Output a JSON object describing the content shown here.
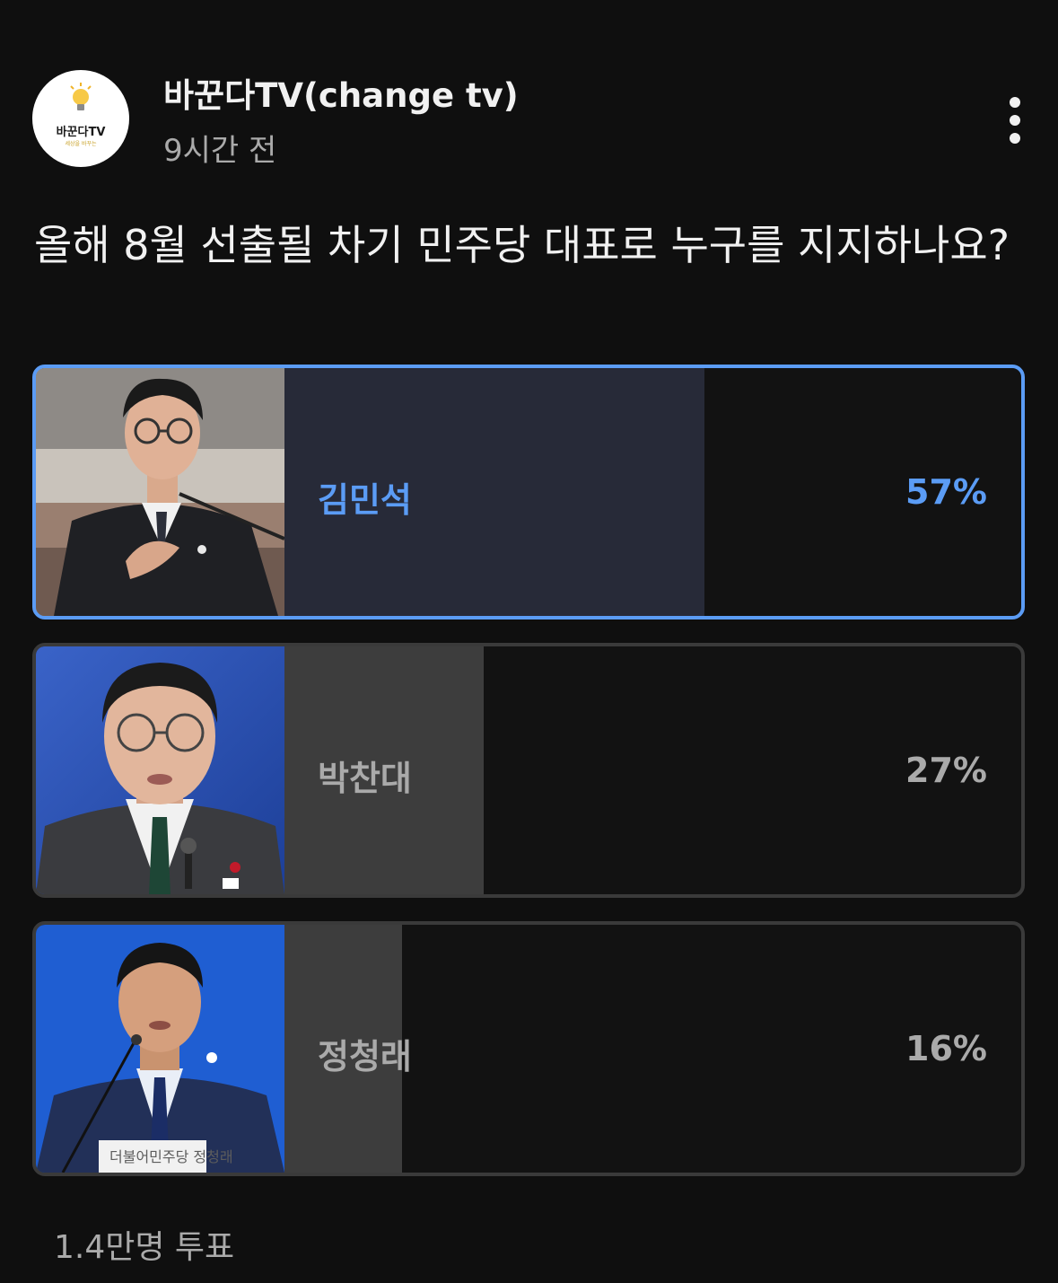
{
  "post": {
    "channel_name": "바꾼다TV(change tv)",
    "avatar_text": "바꾼다TV",
    "avatar_subtext": "세상을 바꾸는",
    "time_ago": "9시간 전",
    "question": "올해 8월 선출될 차기 민주당 대표로 누구를 지지하나요?"
  },
  "poll": {
    "options": [
      {
        "name": "김민석",
        "percent_label": "57%",
        "percent": 57,
        "selected": true
      },
      {
        "name": "박찬대",
        "percent_label": "27%",
        "percent": 27,
        "selected": false
      },
      {
        "name": "정청래",
        "percent_label": "16%",
        "percent": 16,
        "selected": false
      }
    ],
    "photo_captions": [
      "더불어민주당 정청래"
    ],
    "vote_count": "1.4만명 투표"
  },
  "colors": {
    "background": "#0f0f0f",
    "selected_accent": "#5b9cf5",
    "selected_bar": "#272a38",
    "unselected_bar": "#3d3d3d",
    "muted_text": "#aaaaaa"
  },
  "icons": [
    "more-vertical-icon",
    "lightbulb-icon"
  ]
}
